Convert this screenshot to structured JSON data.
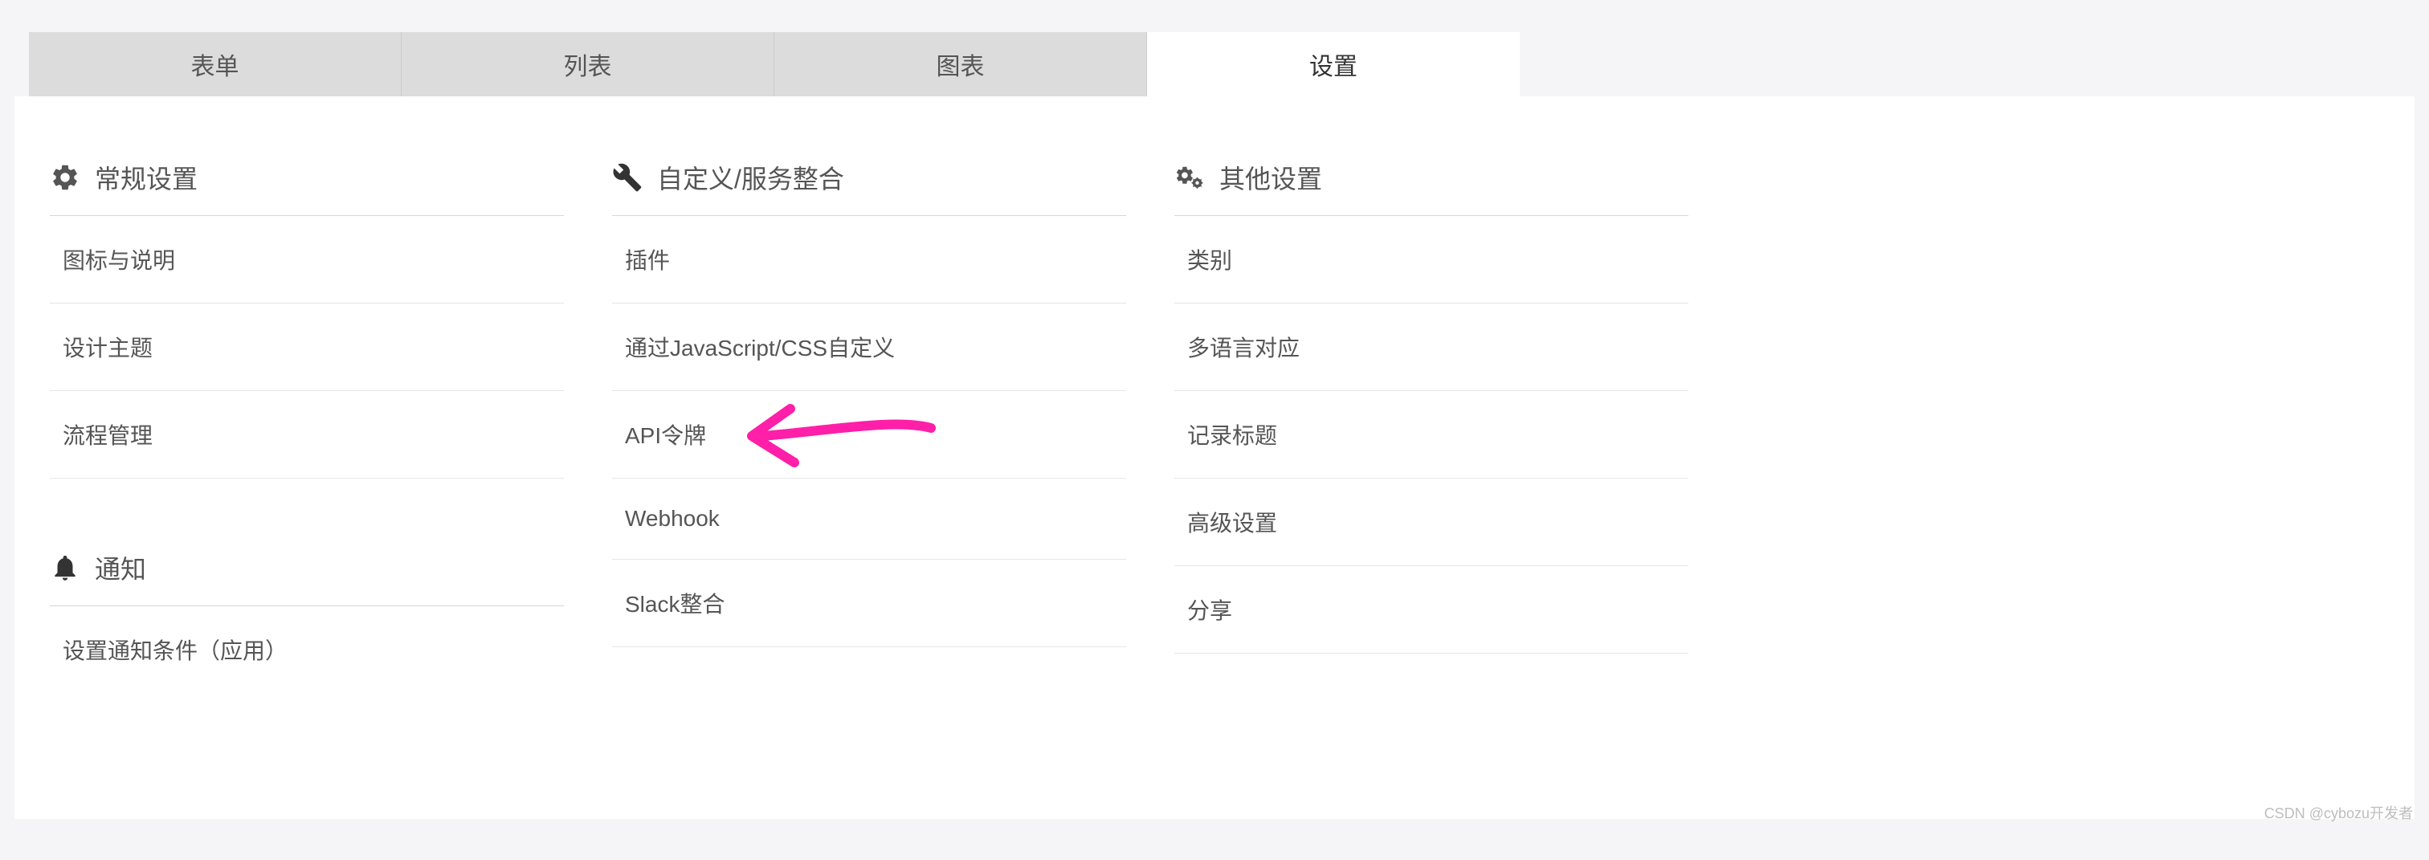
{
  "tabs": [
    {
      "label": "表单"
    },
    {
      "label": "列表"
    },
    {
      "label": "图表"
    },
    {
      "label": "设置"
    }
  ],
  "activeTabIndex": 3,
  "sections": {
    "general": {
      "title": "常规设置",
      "items": [
        {
          "label": "图标与说明"
        },
        {
          "label": "设计主题"
        },
        {
          "label": "流程管理"
        }
      ]
    },
    "notifications": {
      "title": "通知",
      "items": [
        {
          "label": "设置通知条件（应用）"
        }
      ]
    },
    "custom": {
      "title": "自定义/服务整合",
      "items": [
        {
          "label": "插件"
        },
        {
          "label": "通过JavaScript/CSS自定义"
        },
        {
          "label": "API令牌"
        },
        {
          "label": "Webhook"
        },
        {
          "label": "Slack整合"
        }
      ]
    },
    "other": {
      "title": "其他设置",
      "items": [
        {
          "label": "类别"
        },
        {
          "label": "多语言对应"
        },
        {
          "label": "记录标题"
        },
        {
          "label": "高级设置"
        },
        {
          "label": "分享"
        }
      ]
    }
  },
  "annotation": {
    "target": "API令牌",
    "color": "#ff1fa8"
  },
  "watermark": "CSDN @cybozu开发者"
}
